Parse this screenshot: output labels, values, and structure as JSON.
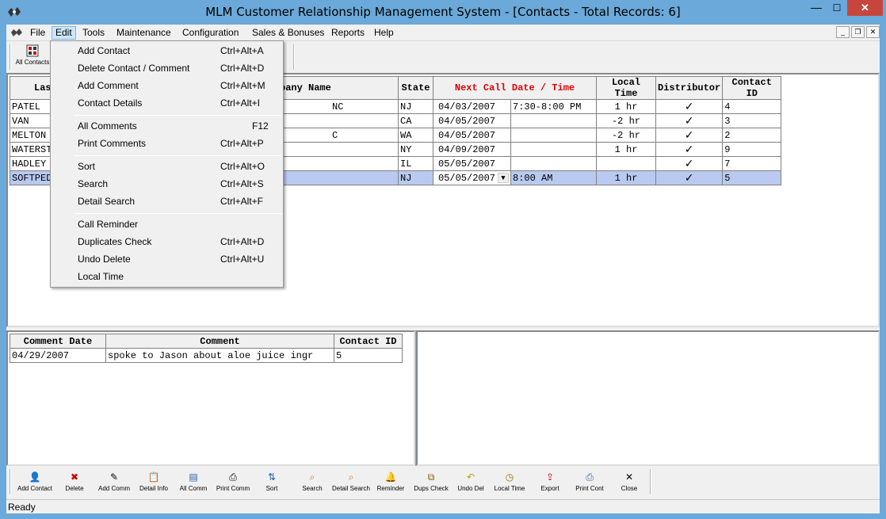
{
  "window": {
    "title": "MLM Customer Relationship Management System - [Contacts - Total Records: 6]",
    "min_glyph": "—",
    "max_glyph": "☐",
    "close_glyph": "✕"
  },
  "menubar": {
    "items": [
      "File",
      "Edit",
      "Tools",
      "Maintenance",
      "Configuration",
      "Sales & Bonuses",
      "Reports",
      "Help"
    ],
    "active": "Edit",
    "mdi_min": "_",
    "mdi_restore": "❐",
    "mdi_close": "✕"
  },
  "top_toolbar": {
    "all_contacts_label": "All Contacts"
  },
  "contacts_grid": {
    "columns": [
      "Last Name",
      "Company Name",
      "State",
      "Next Call Date / Time",
      "Local Time",
      "Distributor",
      "Contact ID"
    ],
    "col_first_visible": "Las",
    "col_company_visible": "pany Name",
    "rows": [
      {
        "last": "PATEL",
        "company": "NC",
        "state": "NJ",
        "date": "04/03/2007",
        "time": "7:30-8:00 PM",
        "local": "1 hr",
        "dist": "✓",
        "id": "4"
      },
      {
        "last": "VAN",
        "company": "",
        "state": "CA",
        "date": "04/05/2007",
        "time": "",
        "local": "-2 hr",
        "dist": "✓",
        "id": "3"
      },
      {
        "last": "MELTON",
        "company": "C",
        "state": "WA",
        "date": "04/05/2007",
        "time": "",
        "local": "-2 hr",
        "dist": "✓",
        "id": "2"
      },
      {
        "last": "WATERST",
        "company": "",
        "state": "NY",
        "date": "04/09/2007",
        "time": "",
        "local": "1 hr",
        "dist": "✓",
        "id": "9"
      },
      {
        "last": "HADLEY",
        "company": "",
        "state": "IL",
        "date": "05/05/2007",
        "time": "",
        "local": "",
        "dist": "✓",
        "id": "7"
      },
      {
        "last": "SOFTPED",
        "company": "",
        "state": "NJ",
        "date": "05/05/2007",
        "time": "8:00 AM",
        "local": "1 hr",
        "dist": "✓",
        "id": "5"
      }
    ]
  },
  "comments_grid": {
    "columns": [
      "Comment Date",
      "Comment",
      "Contact ID"
    ],
    "rows": [
      {
        "date": "04/29/2007",
        "comment": "spoke to Jason about aloe juice ingr",
        "id": "5"
      }
    ]
  },
  "edit_menu": {
    "groups": [
      [
        {
          "label": "Add Contact",
          "shortcut": "Ctrl+Alt+A"
        },
        {
          "label": "Delete Contact / Comment",
          "shortcut": "Ctrl+Alt+D"
        },
        {
          "label": "Add Comment",
          "shortcut": "Ctrl+Alt+M"
        },
        {
          "label": "Contact Details",
          "shortcut": "Ctrl+Alt+I"
        }
      ],
      [
        {
          "label": "All Comments",
          "shortcut": "F12"
        },
        {
          "label": "Print Comments",
          "shortcut": "Ctrl+Alt+P"
        }
      ],
      [
        {
          "label": "Sort",
          "shortcut": "Ctrl+Alt+O"
        },
        {
          "label": "Search",
          "shortcut": "Ctrl+Alt+S"
        },
        {
          "label": "Detail Search",
          "shortcut": "Ctrl+Alt+F"
        }
      ],
      [
        {
          "label": "Call Reminder",
          "shortcut": ""
        },
        {
          "label": "Duplicates Check",
          "shortcut": "Ctrl+Alt+D"
        },
        {
          "label": "Undo Delete",
          "shortcut": "Ctrl+Alt+U"
        },
        {
          "label": "Local Time",
          "shortcut": ""
        }
      ]
    ]
  },
  "bottom_toolbar": {
    "buttons": [
      {
        "label": "Add Contact",
        "icon": "add-contact-icon",
        "glyph": "👤"
      },
      {
        "label": "Delete",
        "icon": "delete-icon",
        "glyph": "✖"
      },
      {
        "label": "Add Comm",
        "icon": "add-comment-icon",
        "glyph": "✎"
      },
      {
        "label": "Detail Info",
        "icon": "clipboard-icon",
        "glyph": "📋"
      },
      {
        "label": "All Comm",
        "icon": "document-icon",
        "glyph": "▤"
      },
      {
        "label": "Print Comm",
        "icon": "printer-icon",
        "glyph": "⎙"
      },
      {
        "label": "Sort",
        "icon": "sort-az-icon",
        "glyph": "⇅"
      },
      {
        "label": "Search",
        "icon": "flashlight-icon",
        "glyph": "⌕"
      },
      {
        "label": "Detail Search",
        "icon": "detail-search-icon",
        "glyph": "⌕"
      },
      {
        "label": "Reminder",
        "icon": "bell-icon",
        "glyph": "🔔"
      },
      {
        "label": "Dups Check",
        "icon": "duplicates-icon",
        "glyph": "⧉"
      },
      {
        "label": "Undo Del",
        "icon": "undo-icon",
        "glyph": "↶"
      },
      {
        "label": "Local Time",
        "icon": "clock-icon",
        "glyph": "◷"
      },
      {
        "label": "Export",
        "icon": "export-icon",
        "glyph": "⇪"
      },
      {
        "label": "Print Cont",
        "icon": "print-contacts-icon",
        "glyph": "⎙"
      },
      {
        "label": "Close",
        "icon": "close-icon",
        "glyph": "✕"
      }
    ]
  },
  "status": {
    "text": "Ready"
  },
  "colors": {
    "window_frame": "#6aa9d9",
    "close_button": "#c7463b",
    "selected_row": "#b9c9f0",
    "header_red": "#e00000"
  }
}
